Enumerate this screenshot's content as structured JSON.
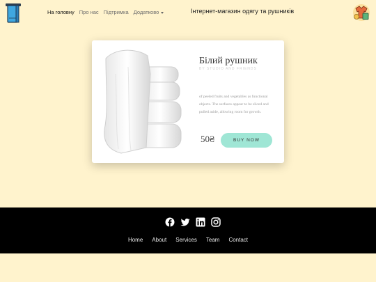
{
  "header": {
    "logo_left": "towel-logo-icon",
    "logo_right": "clothes-logo-icon",
    "nav": [
      "На головну",
      "Про нас",
      "Підтримка",
      "Додатково"
    ],
    "title": "Інтернет-магазин одягу та рушників"
  },
  "product": {
    "image": "white-towels",
    "title": "Білий рушник",
    "subtitle": "BY STUDIO AND FRIENDS",
    "description": "of peeled fruits and vegetables as functional objects. The surfaces appear to be sliced and pulled aside, allowing room for growth.",
    "price": "50₴",
    "buy_label": "BUY NOW"
  },
  "footer": {
    "social_icons": [
      "facebook-icon",
      "twitter-icon",
      "linkedin-icon",
      "instagram-icon"
    ],
    "links": [
      "Home",
      "About",
      "Services",
      "Team",
      "Contact"
    ]
  },
  "colors": {
    "page_bg": "#fff3cd",
    "footer_bg": "#000000",
    "button_bg": "#9fe6d5"
  }
}
